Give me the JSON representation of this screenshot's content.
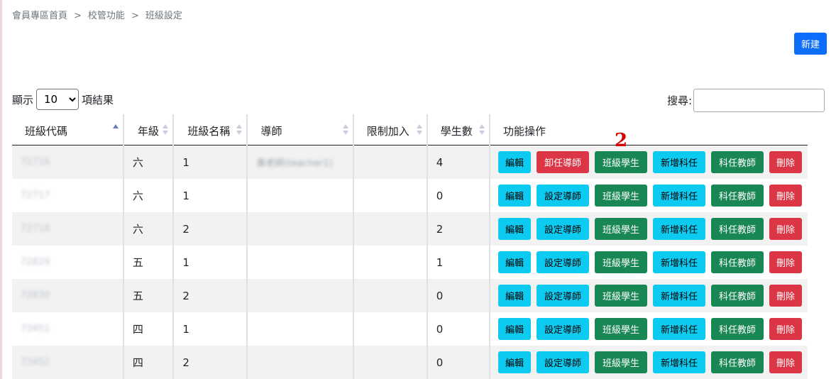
{
  "breadcrumb": [
    "會員專區首頁",
    "校管功能",
    "班級設定"
  ],
  "breadcrumb_sep": ">",
  "new_button": "新建",
  "show": {
    "prefix": "顯示",
    "selected": "10",
    "suffix": "項結果"
  },
  "search": {
    "label": "搜尋:",
    "value": ""
  },
  "columns": [
    "班級代碼",
    "年級",
    "班級名稱",
    "導師",
    "限制加入",
    "學生數",
    "功能操作"
  ],
  "rows": [
    {
      "code": "72716",
      "grade": "六",
      "name": "1",
      "teacher": "黃老師(teacher1)",
      "limit": "",
      "students": "4",
      "tutor_action": "卸任導師"
    },
    {
      "code": "72717",
      "grade": "六",
      "name": "1",
      "teacher": "",
      "limit": "",
      "students": "0",
      "tutor_action": "設定導師"
    },
    {
      "code": "72718",
      "grade": "六",
      "name": "2",
      "teacher": "",
      "limit": "",
      "students": "2",
      "tutor_action": "設定導師"
    },
    {
      "code": "72829",
      "grade": "五",
      "name": "1",
      "teacher": "",
      "limit": "",
      "students": "1",
      "tutor_action": "設定導師"
    },
    {
      "code": "72830",
      "grade": "五",
      "name": "2",
      "teacher": "",
      "limit": "",
      "students": "0",
      "tutor_action": "設定導師"
    },
    {
      "code": "73451",
      "grade": "四",
      "name": "1",
      "teacher": "",
      "limit": "",
      "students": "0",
      "tutor_action": "設定導師"
    },
    {
      "code": "73452",
      "grade": "四",
      "name": "2",
      "teacher": "",
      "limit": "",
      "students": "0",
      "tutor_action": "設定導師"
    }
  ],
  "actions": {
    "edit": "編輯",
    "students": "班級學生",
    "add_subject": "新增科任",
    "subject_teacher": "科任教師",
    "delete": "刪除"
  },
  "annotation": "2",
  "colors": {
    "primary": "#0d6efd",
    "info": "#0dcaf0",
    "success": "#198754",
    "danger": "#dc3545"
  }
}
